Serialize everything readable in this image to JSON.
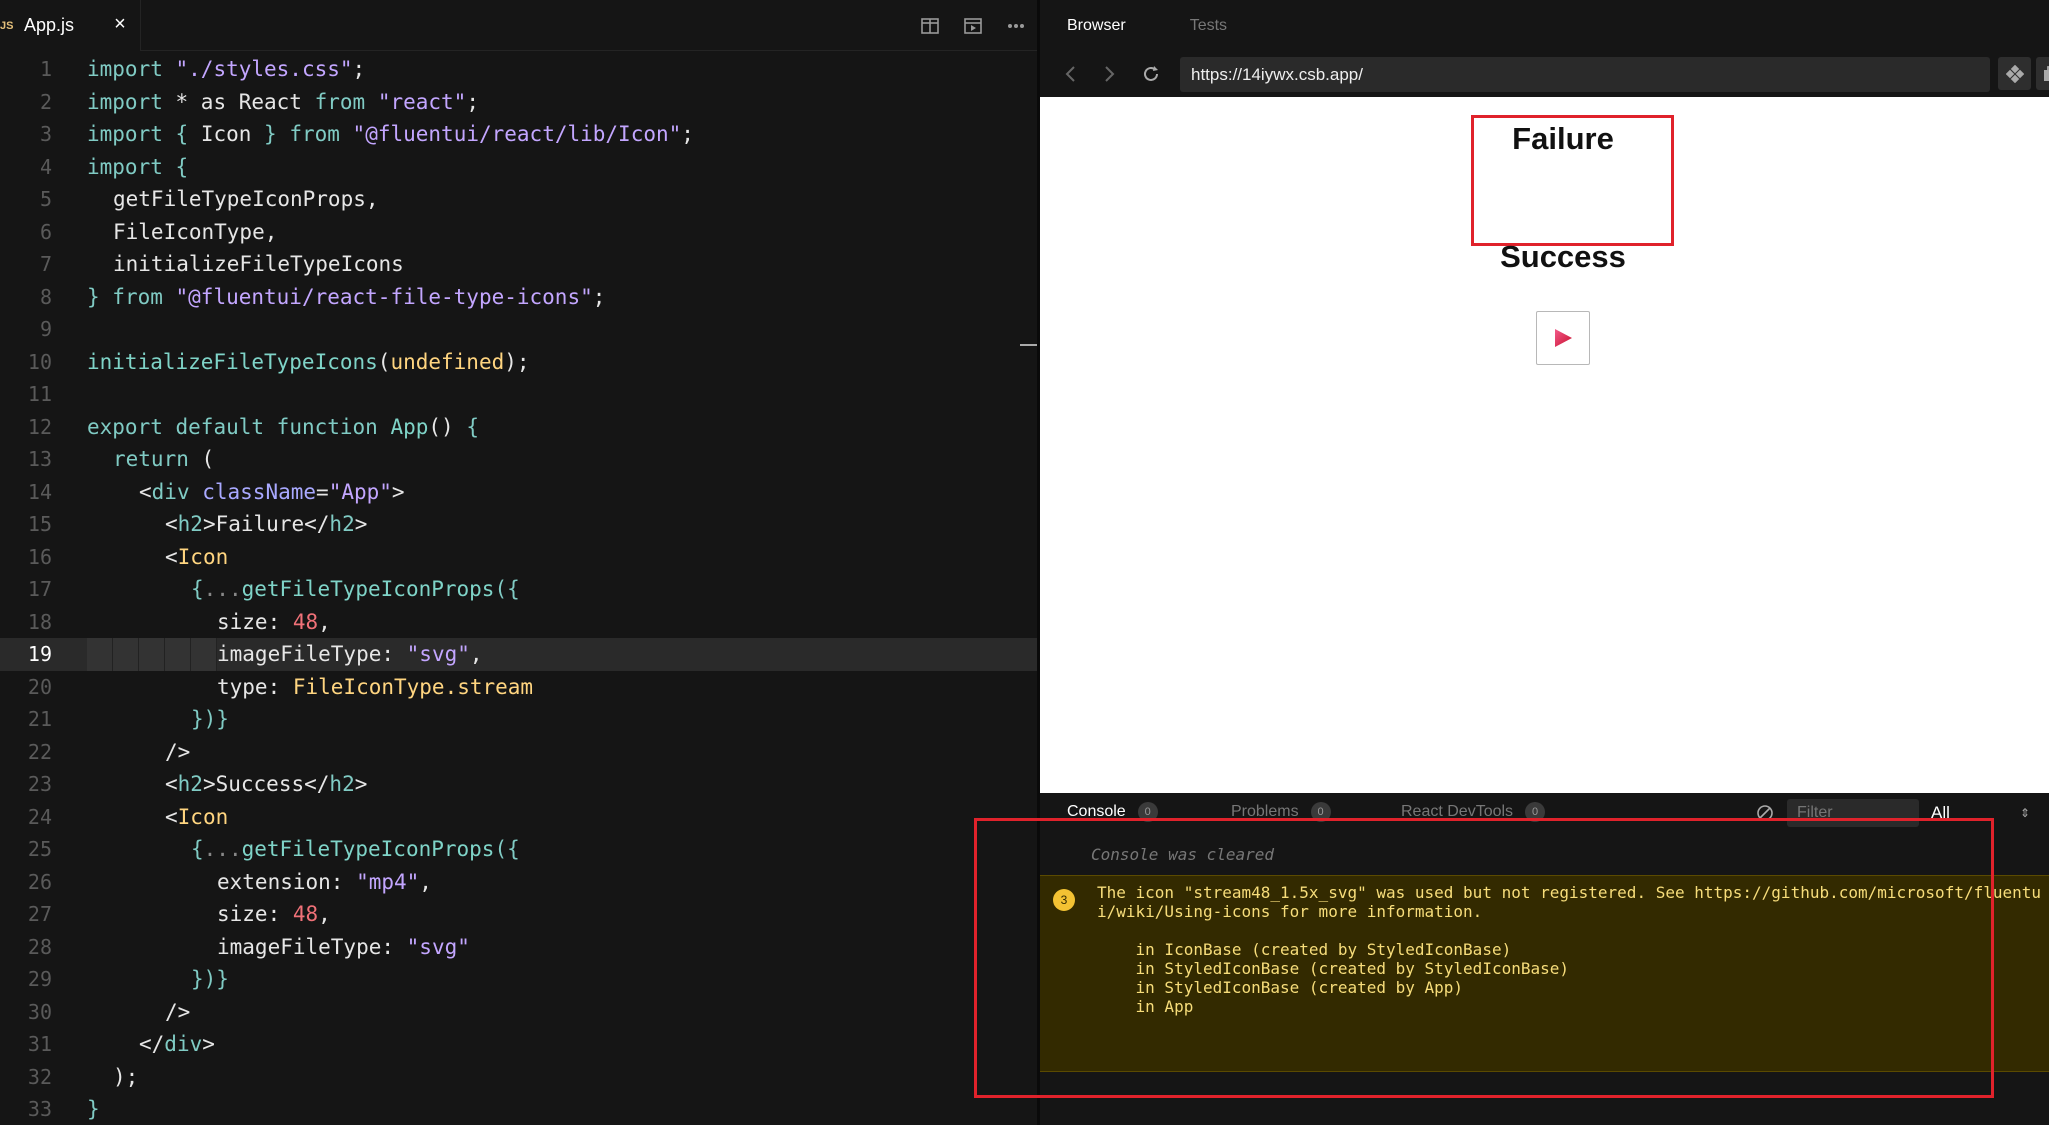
{
  "editor": {
    "file_tab": {
      "icon_text": "JS",
      "name": "App.js",
      "close": "×"
    },
    "actions": [
      "split-icon",
      "preview-icon",
      "more-icon"
    ],
    "active_line": 19,
    "lines": [
      {
        "n": "1"
      },
      {
        "n": "2"
      },
      {
        "n": "3"
      },
      {
        "n": "4"
      },
      {
        "n": "5"
      },
      {
        "n": "6"
      },
      {
        "n": "7"
      },
      {
        "n": "8"
      },
      {
        "n": "9"
      },
      {
        "n": "10"
      },
      {
        "n": "11"
      },
      {
        "n": "12"
      },
      {
        "n": "13"
      },
      {
        "n": "14"
      },
      {
        "n": "15"
      },
      {
        "n": "16"
      },
      {
        "n": "17"
      },
      {
        "n": "18"
      },
      {
        "n": "19"
      },
      {
        "n": "20"
      },
      {
        "n": "21"
      },
      {
        "n": "22"
      },
      {
        "n": "23"
      },
      {
        "n": "24"
      },
      {
        "n": "25"
      },
      {
        "n": "26"
      },
      {
        "n": "27"
      },
      {
        "n": "28"
      },
      {
        "n": "29"
      },
      {
        "n": "30"
      },
      {
        "n": "31"
      },
      {
        "n": "32"
      },
      {
        "n": "33"
      }
    ],
    "code": {
      "l1": {
        "a": "import ",
        "b": "\"./styles.css\"",
        "c": ";"
      },
      "l2": {
        "a": "import ",
        "b": "* as ",
        "c": "React ",
        "d": "from ",
        "e": "\"react\"",
        "f": ";"
      },
      "l3": {
        "a": "import ",
        "b": "{ ",
        "c": "Icon ",
        "d": "} ",
        "e": "from ",
        "f": "\"@fluentui/react/lib/Icon\"",
        "g": ";"
      },
      "l4": {
        "a": "import ",
        "b": "{"
      },
      "l5": {
        "a": "getFileTypeIconProps,"
      },
      "l6": {
        "a": "FileIconType,"
      },
      "l7": {
        "a": "initializeFileTypeIcons"
      },
      "l8": {
        "a": "} ",
        "b": "from ",
        "c": "\"@fluentui/react-file-type-icons\"",
        "d": ";"
      },
      "l10": {
        "a": "initializeFileTypeIcons",
        "b": "(",
        "c": "undefined",
        "d": ");"
      },
      "l12": {
        "a": "export ",
        "b": "default ",
        "c": "function ",
        "d": "App",
        "e": "() ",
        "f": "{"
      },
      "l13": {
        "a": "return ",
        "b": "("
      },
      "l14": {
        "a": "<",
        "b": "div ",
        "c": "className",
        "d": "=",
        "e": "\"App\"",
        "f": ">"
      },
      "l15": {
        "a": "<",
        "b": "h2",
        "c": ">",
        "d": "Failure",
        "e": "</",
        "f": "h2",
        "g": ">"
      },
      "l16": {
        "a": "<",
        "b": "Icon"
      },
      "l17": {
        "a": "{",
        "b": "...",
        "c": "getFileTypeIconProps",
        "d": "({"
      },
      "l18": {
        "a": "size: ",
        "b": "48",
        "c": ","
      },
      "l19": {
        "a": "imageFileType: ",
        "b": "\"svg\"",
        "c": ","
      },
      "l20": {
        "a": "type: ",
        "b": "FileIconType.stream"
      },
      "l21": {
        "a": "})}"
      },
      "l22": {
        "a": "/>"
      },
      "l23": {
        "a": "<",
        "b": "h2",
        "c": ">",
        "d": "Success",
        "e": "</",
        "f": "h2",
        "g": ">"
      },
      "l24": {
        "a": "<",
        "b": "Icon"
      },
      "l25": {
        "a": "{",
        "b": "...",
        "c": "getFileTypeIconProps",
        "d": "({"
      },
      "l26": {
        "a": "extension: ",
        "b": "\"mp4\"",
        "c": ","
      },
      "l27": {
        "a": "size: ",
        "b": "48",
        "c": ","
      },
      "l28": {
        "a": "imageFileType: ",
        "b": "\"svg\""
      },
      "l29": {
        "a": "})}"
      },
      "l30": {
        "a": "/>"
      },
      "l31": {
        "a": "</",
        "b": "div",
        "c": ">"
      },
      "l32": {
        "a": ");"
      },
      "l33": {
        "a": "}"
      }
    }
  },
  "right": {
    "tabs": {
      "browser": "Browser",
      "tests": "Tests"
    },
    "url": "https://14iywx.csb.app/",
    "page": {
      "h2_failure": "Failure",
      "h2_success": "Success"
    },
    "console": {
      "tabs": {
        "console": "Console",
        "problems": "Problems",
        "devtools": "React DevTools"
      },
      "badges": {
        "console": "0",
        "problems": "0",
        "devtools": "0"
      },
      "filter_placeholder": "Filter",
      "level": "All",
      "cleared": "Console was cleared",
      "warning_count": "3",
      "warning_lines": [
        "The icon \"stream48_1.5x_svg\" was used but not registered. See https://github.com/microsoft/fluentu",
        "i/wiki/Using-icons for more information.",
        "",
        "    in IconBase (created by StyledIconBase)",
        "    in StyledIconBase (created by StyledIconBase)",
        "    in StyledIconBase (created by App)",
        "    in App"
      ]
    }
  },
  "colors": {
    "editor_bg": "#151515",
    "highlight_red": "#e0222b",
    "warning_bg": "#332a00",
    "warning_text": "#f7dd7a"
  }
}
